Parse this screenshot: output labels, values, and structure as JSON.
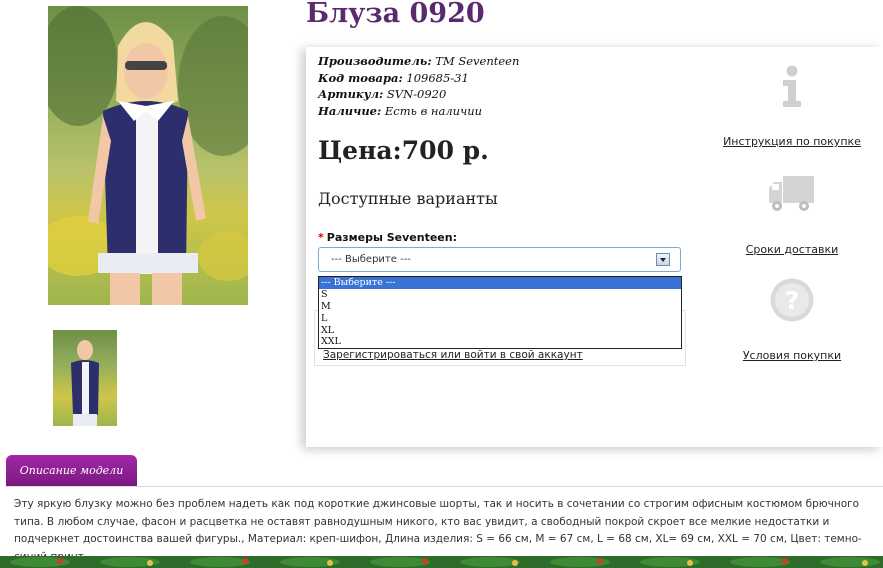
{
  "product": {
    "title": "Блуза 0920",
    "manufacturer_label": "Производитель:",
    "manufacturer": "TM Seventeen",
    "code_label": "Код товара:",
    "code": "109685-31",
    "article_label": "Артикул:",
    "article": "SVN-0920",
    "availability_label": "Наличие:",
    "availability": "Есть в наличии",
    "price": "Цена:700 р."
  },
  "options": {
    "heading": "Доступные варианты",
    "required_mark": "*",
    "size_label": "Размеры Seventeen:",
    "selected": "--- Выберите ---",
    "dropdown_items": [
      "--- Выберите ---",
      "S",
      "M",
      "L",
      "XL",
      "XXL"
    ]
  },
  "account": {
    "login_link": "Зарегистрироваться или войти в свой аккаунт"
  },
  "sidebar": {
    "items": [
      {
        "label": "Инструкция по покупке",
        "icon": "info-icon"
      },
      {
        "label": "Сроки доставки",
        "icon": "truck-icon"
      },
      {
        "label": "Условия покупки",
        "icon": "question-icon"
      }
    ]
  },
  "description": {
    "tab_label": "Описание модели",
    "text": "Эту яркую блузку можно без проблем надеть как под короткие джинсовые шорты, так и носить в сочетании со строгим офисным костюмом брючного типа. В любом случае, фасон и расцветка не оставят равнодушным никого, кто вас увидит, а свободный покрой скроет все мелкие недостатки и подчеркнет достоинства вашей фигуры., Материал: креп-шифон, Длина изделия: S = 66 см, M = 67 см, L = 68 см, XL= 69 см, XXL = 70 см, Цвет: темно-синий принт"
  },
  "colors": {
    "title": "#5b2a6e",
    "tab": "#a326a8",
    "select_highlight": "#3a73d6",
    "blouse": "#2c2f6b"
  }
}
